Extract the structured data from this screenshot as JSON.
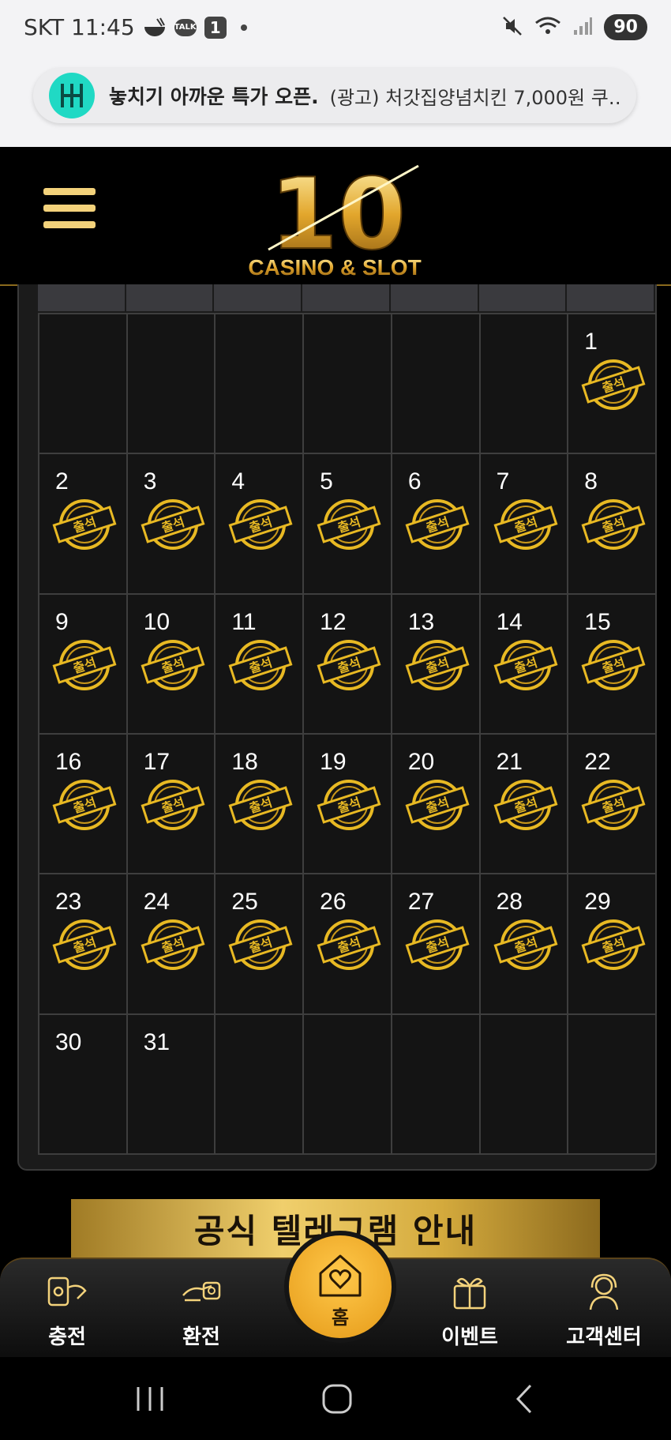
{
  "status_bar": {
    "carrier_time": "SKT 11:45",
    "talk_label": "TALK",
    "badge_count": "1",
    "battery": "90"
  },
  "notification": {
    "title": "놓치기 아까운 특가 오픈.",
    "text": "(광고) 처갓집양념치킨 7,000원 쿠…"
  },
  "header": {
    "logo_number": "10",
    "logo_subtitle": "CASINO & SLOT"
  },
  "calendar": {
    "stamp_label": "출석",
    "weeks": [
      [
        {
          "day": "",
          "stamped": false
        },
        {
          "day": "",
          "stamped": false
        },
        {
          "day": "",
          "stamped": false
        },
        {
          "day": "",
          "stamped": false
        },
        {
          "day": "",
          "stamped": false
        },
        {
          "day": "",
          "stamped": false
        },
        {
          "day": "1",
          "stamped": true
        }
      ],
      [
        {
          "day": "2",
          "stamped": true
        },
        {
          "day": "3",
          "stamped": true
        },
        {
          "day": "4",
          "stamped": true
        },
        {
          "day": "5",
          "stamped": true
        },
        {
          "day": "6",
          "stamped": true
        },
        {
          "day": "7",
          "stamped": true
        },
        {
          "day": "8",
          "stamped": true
        }
      ],
      [
        {
          "day": "9",
          "stamped": true
        },
        {
          "day": "10",
          "stamped": true
        },
        {
          "day": "11",
          "stamped": true
        },
        {
          "day": "12",
          "stamped": true
        },
        {
          "day": "13",
          "stamped": true
        },
        {
          "day": "14",
          "stamped": true
        },
        {
          "day": "15",
          "stamped": true
        }
      ],
      [
        {
          "day": "16",
          "stamped": true
        },
        {
          "day": "17",
          "stamped": true
        },
        {
          "day": "18",
          "stamped": true
        },
        {
          "day": "19",
          "stamped": true
        },
        {
          "day": "20",
          "stamped": true
        },
        {
          "day": "21",
          "stamped": true
        },
        {
          "day": "22",
          "stamped": true
        }
      ],
      [
        {
          "day": "23",
          "stamped": true
        },
        {
          "day": "24",
          "stamped": true
        },
        {
          "day": "25",
          "stamped": true
        },
        {
          "day": "26",
          "stamped": true
        },
        {
          "day": "27",
          "stamped": true
        },
        {
          "day": "28",
          "stamped": true
        },
        {
          "day": "29",
          "stamped": true
        }
      ],
      [
        {
          "day": "30",
          "stamped": false
        },
        {
          "day": "31",
          "stamped": false
        },
        {
          "day": "",
          "stamped": false
        },
        {
          "day": "",
          "stamped": false
        },
        {
          "day": "",
          "stamped": false
        },
        {
          "day": "",
          "stamped": false
        },
        {
          "day": "",
          "stamped": false
        }
      ]
    ]
  },
  "telegram_banner": {
    "text": "공식 텔레그램 안내"
  },
  "bottom_nav": {
    "deposit": "충전",
    "withdraw": "환전",
    "home": "홈",
    "event": "이벤트",
    "support": "고객센터"
  },
  "colors": {
    "gold": "#f3d27b",
    "accent_orange": "#f0a82a",
    "background": "#000000"
  }
}
